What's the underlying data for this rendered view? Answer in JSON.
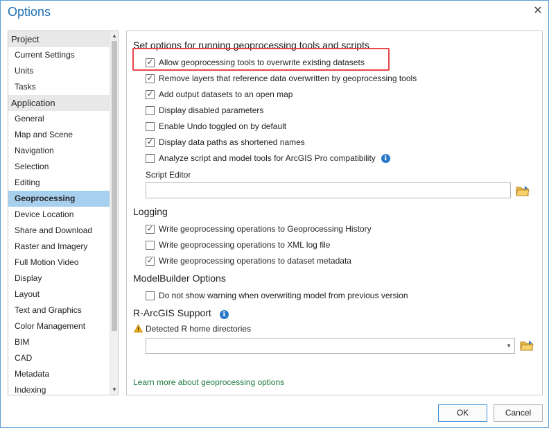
{
  "window": {
    "title": "Options",
    "close_glyph": "✕"
  },
  "sidebar": {
    "groups": [
      {
        "label": "Project",
        "items": [
          "Current Settings",
          "Units",
          "Tasks"
        ]
      },
      {
        "label": "Application",
        "items": [
          "General",
          "Map and Scene",
          "Navigation",
          "Selection",
          "Editing",
          "Geoprocessing",
          "Device Location",
          "Share and Download",
          "Raster and Imagery",
          "Full Motion Video",
          "Display",
          "Layout",
          "Text and Graphics",
          "Color Management",
          "BIM",
          "CAD",
          "Metadata",
          "Indexing"
        ]
      }
    ],
    "selected_item": "Geoprocessing"
  },
  "content": {
    "header": "Set options for running geoprocessing tools and scripts",
    "options": [
      {
        "label": "Allow geoprocessing tools to overwrite existing datasets",
        "checked": true
      },
      {
        "label": "Remove layers that reference data overwritten by geoprocessing tools",
        "checked": true
      },
      {
        "label": "Add output datasets to an open map",
        "checked": true
      },
      {
        "label": "Display disabled parameters",
        "checked": false
      },
      {
        "label": "Enable Undo toggled on by default",
        "checked": false
      },
      {
        "label": "Display data paths as shortened names",
        "checked": true
      },
      {
        "label": "Analyze script and model tools for ArcGIS Pro compatibility",
        "checked": false
      }
    ],
    "script_editor_label": "Script Editor",
    "script_editor_value": "",
    "logging": {
      "header": "Logging",
      "options": [
        {
          "label": "Write geoprocessing operations to Geoprocessing History",
          "checked": true
        },
        {
          "label": "Write geoprocessing operations to XML log file",
          "checked": false
        },
        {
          "label": "Write geoprocessing operations to dataset metadata",
          "checked": true
        }
      ]
    },
    "modelbuilder": {
      "header": "ModelBuilder Options",
      "options": [
        {
          "label": "Do not show warning when overwriting model from previous version",
          "checked": false
        }
      ]
    },
    "r_arcgis": {
      "header": "R-ArcGIS Support",
      "detected_label": "Detected R home directories",
      "selected_value": ""
    },
    "learn_more_link": "Learn more about geoprocessing options"
  },
  "buttons": {
    "ok": "OK",
    "cancel": "Cancel"
  },
  "icons": {
    "info": "i",
    "check": "✓",
    "scroll_up": "▲",
    "scroll_down": "▼",
    "dropdown": "▼"
  },
  "colors": {
    "title": "#1f6fb5",
    "selected_bg": "#a7d0ef",
    "highlight_border": "#e8454a",
    "link": "#1a7a3a",
    "info_icon": "#2a79c9"
  }
}
